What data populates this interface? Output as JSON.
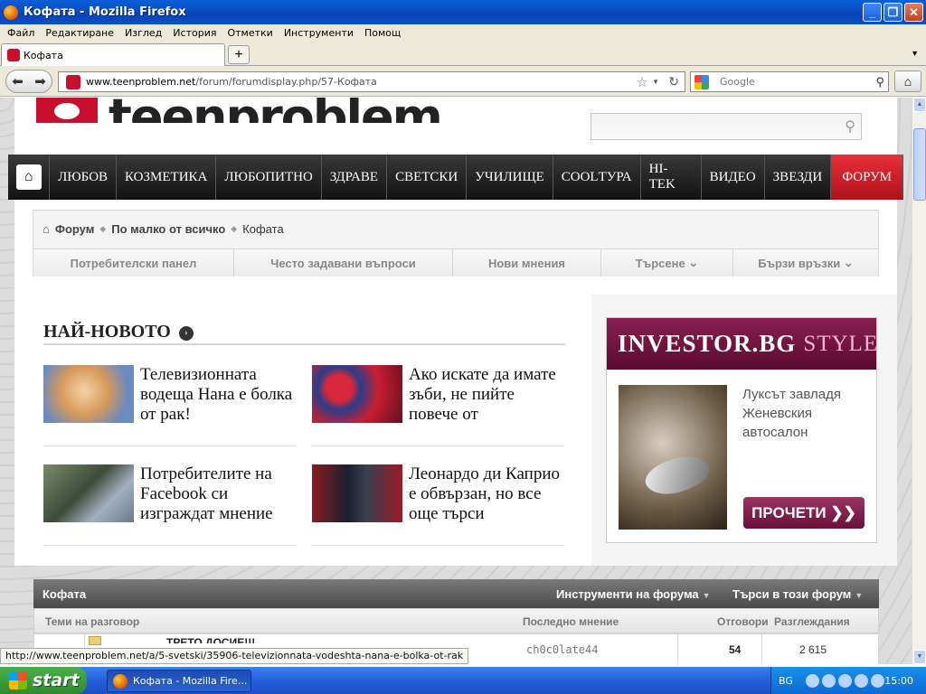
{
  "window": {
    "title": "Кофата - Mozilla Firefox",
    "min": "_",
    "max": "❐",
    "close": "✕"
  },
  "menu": [
    "Файл",
    "Редактиране",
    "Изглед",
    "История",
    "Отметки",
    "Инструменти",
    "Помощ"
  ],
  "tabs": [
    {
      "label": "Кофата"
    }
  ],
  "newtab_label": "+",
  "nav": {
    "url_domain": "www.teenproblem.net",
    "url_path": "/forum/forumdisplay.php/57-Кофата",
    "search_placeholder": "Google"
  },
  "site": {
    "logo_text": "teenproblem",
    "topnav": [
      "ЛЮБОВ",
      "КОЗМЕТИКА",
      "ЛЮБОПИТНО",
      "ЗДРАВЕ",
      "СВЕТСКИ",
      "УЧИЛИЩЕ",
      "COOLТУРА",
      "HI-TEK",
      "ВИДЕО",
      "ЗВЕЗДИ"
    ],
    "topnav_active": "ФОРУМ",
    "breadcrumb": [
      "Форум",
      "По малко от всичко",
      "Кофата"
    ],
    "subnav": [
      "Потребителски панел",
      "Често задавани въпроси",
      "Нови мнения",
      "Търсене",
      "Бързи връзки"
    ],
    "newest_title": "НАЙ-НОВОТО",
    "news": [
      {
        "title": "Телевизионната водеща Нана е болка от рак!"
      },
      {
        "title": "Ако искате да имате зъби, не пийте повече от"
      },
      {
        "title": "Потребителите на Facebook си изграждат мнение"
      },
      {
        "title": "Леонардо ди Каприо е обвързан, но все още търси"
      }
    ],
    "ad": {
      "brand": "INVESTOR.BG",
      "brand_sub": "STYLE",
      "copy": "Луксът завладя Женевския автосалон",
      "button": "ПРОЧЕТИ ❯❯"
    },
    "forum": {
      "name": "Кофата",
      "tools": "Инструменти на форума",
      "search": "Търси в този форум",
      "columns": {
        "threads": "Теми на разговор",
        "last": "Последно мнение",
        "replies": "Отговори",
        "views": "Разглеждания"
      },
      "rows": [
        {
          "title": "ТРЕТО ДОСИЕ!!!",
          "last_user": "ch0c0late44",
          "replies": "54",
          "views": "2 615"
        }
      ]
    }
  },
  "status_text": "http://www.teenproblem.net/a/5-svetski/35906-televizionnata-vodeshta-nana-e-bolka-ot-rak",
  "taskbar": {
    "start": "start",
    "item": "Кофата - Mozilla Fire...",
    "lang": "BG",
    "clock": "15:00"
  },
  "colors": {
    "accent_red": "#c8102e",
    "xp_blue": "#245ddb"
  }
}
